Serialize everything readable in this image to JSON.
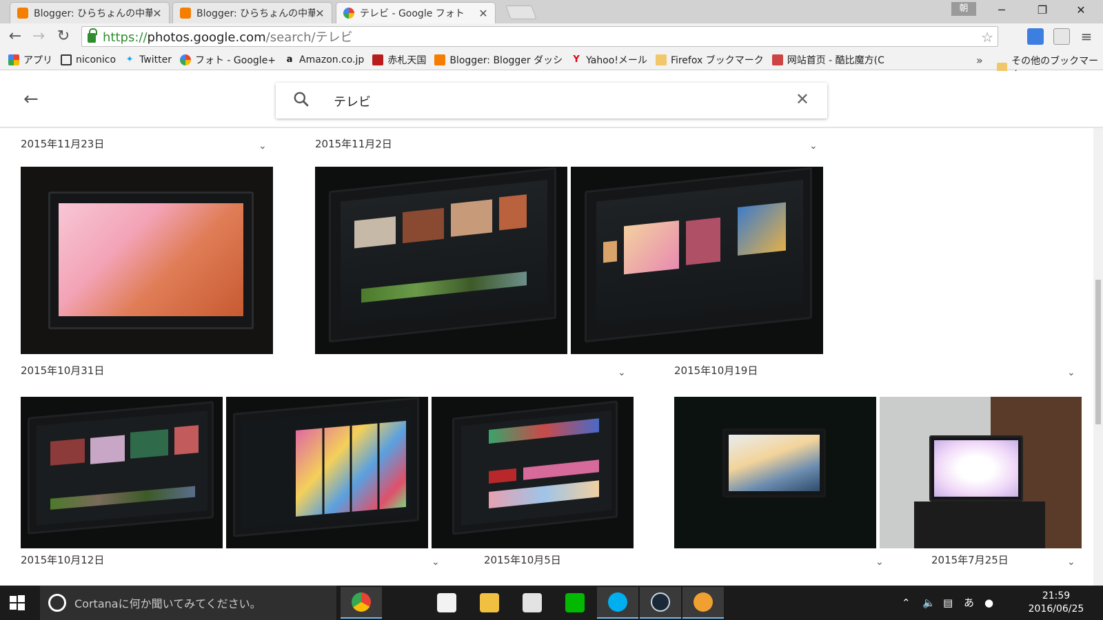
{
  "browser": {
    "tabs": [
      {
        "title": "Blogger: ひらちょんの中華端",
        "favicon": "blogger-icon",
        "active": false
      },
      {
        "title": "Blogger: ひらちょんの中華端",
        "favicon": "blogger-icon",
        "active": false
      },
      {
        "title": "テレビ - Google フォト",
        "favicon": "google-photos-icon",
        "active": true
      }
    ],
    "ime_badge": "朝",
    "window_controls": {
      "minimize": "─",
      "restore": "❐",
      "close": "✕"
    },
    "url": {
      "scheme": "https://",
      "host": "photos.google.com",
      "path": "/search/テレビ"
    },
    "bookmarks": [
      {
        "label": "アプリ",
        "icon": "apps-grid-icon"
      },
      {
        "label": "niconico",
        "icon": "niconico-icon"
      },
      {
        "label": "Twitter",
        "icon": "twitter-bird-icon"
      },
      {
        "label": "フォト - Google+",
        "icon": "google-photos-icon"
      },
      {
        "label": "Amazon.co.jp",
        "icon": "amazon-icon"
      },
      {
        "label": "赤札天国",
        "icon": "akafuda-icon"
      },
      {
        "label": "Blogger: Blogger ダッシ",
        "icon": "blogger-icon"
      },
      {
        "label": "Yahoo!メール",
        "icon": "yahoo-icon"
      },
      {
        "label": "Firefox ブックマーク",
        "icon": "folder-icon"
      },
      {
        "label": "网站首页 - 酷比魔方(C",
        "icon": "cube-icon"
      }
    ],
    "bookmarks_more": "»",
    "other_bookmarks": "その他のブックマーク"
  },
  "app": {
    "search_query": "テレビ",
    "groups": [
      {
        "date": "2015年11月23日",
        "photos": [
          {
            "screen": "pink-orange"
          }
        ]
      },
      {
        "date": "2015年11月2日",
        "photos": [
          {
            "screen": "dark-grid"
          },
          {
            "screen": "anime-grid"
          }
        ]
      },
      {
        "date": "2015年10月31日",
        "photos": [
          {
            "screen": "dark-grid"
          },
          {
            "screen": "colorful-grid"
          },
          {
            "screen": "netflix"
          }
        ]
      },
      {
        "date": "2015年10月19日",
        "photos": [
          {
            "screen": "anime-scene"
          },
          {
            "screen": "bright-white"
          }
        ]
      },
      {
        "date": "2015年10月12日",
        "photos": []
      },
      {
        "date": "2015年10月5日",
        "photos": []
      },
      {
        "date": "2015年7月25日",
        "photos": []
      }
    ]
  },
  "taskbar": {
    "cortana_placeholder": "Cortanaに何か聞いてみてください。",
    "apps": [
      "chrome-icon",
      "store-icon",
      "file-explorer-icon",
      "paint-icon",
      "line-icon",
      "skype-icon",
      "steam-icon",
      "media-icon"
    ],
    "ime": "あ",
    "time": "21:59",
    "date": "2016/06/25"
  },
  "colors": {
    "https_green": "#2f8d2f",
    "taskbar": "#1b1b1b",
    "photo_bg": "#0c0f0e"
  }
}
